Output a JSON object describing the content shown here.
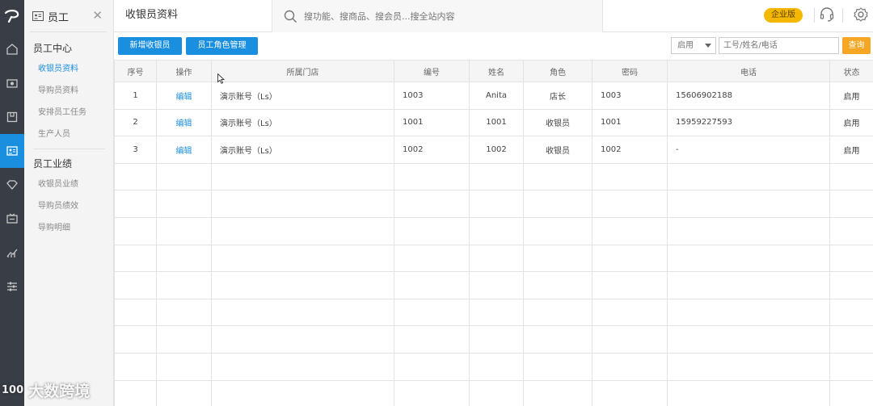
{
  "sidebar": {
    "title": "员工",
    "groups": [
      {
        "label": "员工中心",
        "items": [
          "收银员资料",
          "导购员资料",
          "安排员工任务",
          "生产人员"
        ]
      },
      {
        "label": "员工业绩",
        "items": [
          "收银员业绩",
          "导购员绩效",
          "导购明细"
        ]
      }
    ]
  },
  "header": {
    "page_title": "收银员资料",
    "search_placeholder": "搜功能、搜商品、搜会员...搜全站内容",
    "edition_badge": "企业版"
  },
  "toolbar": {
    "add_button": "新增收银员",
    "role_button": "员工角色管理",
    "status_select": "启用",
    "query_placeholder": "工号/姓名/电话",
    "query_button": "查询"
  },
  "table": {
    "columns": [
      "序号",
      "操作",
      "所属门店",
      "编号",
      "姓名",
      "角色",
      "密码",
      "电话",
      "状态"
    ],
    "rows": [
      [
        "1",
        "编辑",
        "演示账号（Ls）",
        "1003",
        "Anita",
        "店长",
        "1003",
        "15606902188",
        "启用"
      ],
      [
        "2",
        "编辑",
        "演示账号（Ls）",
        "1001",
        "1001",
        "收银员",
        "1001",
        "15959227593",
        "启用"
      ],
      [
        "3",
        "编辑",
        "演示账号（Ls）",
        "1002",
        "1002",
        "收银员",
        "1002",
        "-",
        "启用"
      ]
    ]
  },
  "watermark": {
    "mark": "100",
    "text": "大数跨境"
  },
  "colors": {
    "primary": "#1a8fe0",
    "rail": "#393d46",
    "badge": "#f5b800",
    "query": "#f5a623"
  }
}
